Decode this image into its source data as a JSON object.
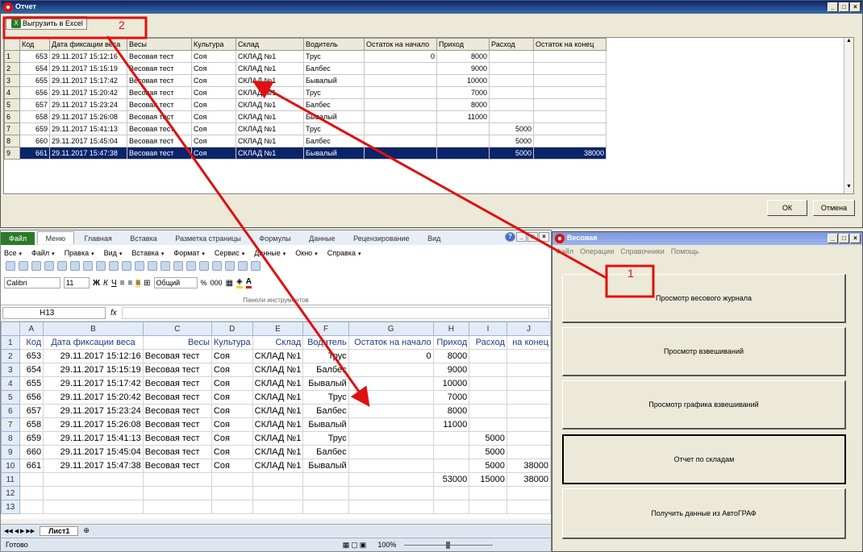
{
  "report": {
    "title": "Отчет",
    "export_label": "Выгрузить в Excel",
    "columns": [
      "Код",
      "Дата фиксации веса",
      "Весы",
      "Культура",
      "Склад",
      "Водитель",
      "Остаток на начало",
      "Приход",
      "Расход",
      "Остаток на конец"
    ],
    "rows": [
      [
        "1",
        "653",
        "29.11.2017 15:12:16",
        "Весовая тест",
        "Соя",
        "СКЛАД №1",
        "Трус",
        "0",
        "8000",
        "",
        ""
      ],
      [
        "2",
        "654",
        "29.11.2017 15:15:19",
        "Весовая тест",
        "Соя",
        "СКЛАД №1",
        "Балбес",
        "",
        "9000",
        "",
        ""
      ],
      [
        "3",
        "655",
        "29.11.2017 15:17:42",
        "Весовая тест",
        "Соя",
        "СКЛАД №1",
        "Бывалый",
        "",
        "10000",
        "",
        ""
      ],
      [
        "4",
        "656",
        "29.11.2017 15:20:42",
        "Весовая тест",
        "Соя",
        "СКЛАД №1",
        "Трус",
        "",
        "7000",
        "",
        ""
      ],
      [
        "5",
        "657",
        "29.11.2017 15:23:24",
        "Весовая тест",
        "Соя",
        "СКЛАД №1",
        "Балбес",
        "",
        "8000",
        "",
        ""
      ],
      [
        "6",
        "658",
        "29.11.2017 15:26:08",
        "Весовая тест",
        "Соя",
        "СКЛАД №1",
        "Бывалый",
        "",
        "11000",
        "",
        ""
      ],
      [
        "7",
        "659",
        "29.11.2017 15:41:13",
        "Весовая тест",
        "Соя",
        "СКЛАД №1",
        "Трус",
        "",
        "",
        "5000",
        ""
      ],
      [
        "8",
        "660",
        "29.11.2017 15:45:04",
        "Весовая тест",
        "Соя",
        "СКЛАД №1",
        "Балбес",
        "",
        "",
        "5000",
        ""
      ],
      [
        "9",
        "661",
        "29.11.2017 15:47:38",
        "Весовая тест",
        "Соя",
        "СКЛАД №1",
        "Бывалый",
        "",
        "",
        "5000",
        "38000"
      ]
    ],
    "ok_label": "ОК",
    "cancel_label": "Отмена"
  },
  "excel": {
    "tabs": [
      "Файл",
      "Меню",
      "Главная",
      "Вставка",
      "Разметка страницы",
      "Формулы",
      "Данные",
      "Рецензирование",
      "Вид"
    ],
    "menus": [
      "Все",
      "Файл",
      "Правка",
      "Вид",
      "Вставка",
      "Формат",
      "Сервис",
      "Данные",
      "Окно",
      "Справка"
    ],
    "font": "Calibri",
    "font_size": "11",
    "number_format": "Общий",
    "toolbar_group": "Панели инструментов",
    "name_box": "H13",
    "fx": "fx",
    "col_headers": [
      "A",
      "B",
      "C",
      "D",
      "E",
      "F",
      "G",
      "H",
      "I",
      "J"
    ],
    "rows": [
      [
        "1",
        "Код",
        "Дата фиксации веса",
        "Весы",
        "Культура",
        "Склад",
        "Водитель",
        "Остаток на начало",
        "Приход",
        "Расход",
        "на конец"
      ],
      [
        "2",
        "653",
        "29.11.2017 15:12:16",
        "Весовая тест",
        "Соя",
        "СКЛАД №1",
        "Трус",
        "0",
        "8000",
        "",
        ""
      ],
      [
        "3",
        "654",
        "29.11.2017 15:15:19",
        "Весовая тест",
        "Соя",
        "СКЛАД №1",
        "Балбес",
        "",
        "9000",
        "",
        ""
      ],
      [
        "4",
        "655",
        "29.11.2017 15:17:42",
        "Весовая тест",
        "Соя",
        "СКЛАД №1",
        "Бывалый",
        "",
        "10000",
        "",
        ""
      ],
      [
        "5",
        "656",
        "29.11.2017 15:20:42",
        "Весовая тест",
        "Соя",
        "СКЛАД №1",
        "Трус",
        "",
        "7000",
        "",
        ""
      ],
      [
        "6",
        "657",
        "29.11.2017 15:23:24",
        "Весовая тест",
        "Соя",
        "СКЛАД №1",
        "Балбес",
        "",
        "8000",
        "",
        ""
      ],
      [
        "7",
        "658",
        "29.11.2017 15:26:08",
        "Весовая тест",
        "Соя",
        "СКЛАД №1",
        "Бывалый",
        "",
        "11000",
        "",
        ""
      ],
      [
        "8",
        "659",
        "29.11.2017 15:41:13",
        "Весовая тест",
        "Соя",
        "СКЛАД №1",
        "Трус",
        "",
        "",
        "5000",
        ""
      ],
      [
        "9",
        "660",
        "29.11.2017 15:45:04",
        "Весовая тест",
        "Соя",
        "СКЛАД №1",
        "Балбес",
        "",
        "",
        "5000",
        ""
      ],
      [
        "10",
        "661",
        "29.11.2017 15:47:38",
        "Весовая тест",
        "Соя",
        "СКЛАД №1",
        "Бывалый",
        "",
        "",
        "5000",
        "38000"
      ],
      [
        "11",
        "",
        "",
        "",
        "",
        "",
        "",
        "",
        "53000",
        "15000",
        "38000"
      ],
      [
        "12",
        "",
        "",
        "",
        "",
        "",
        "",
        "",
        "",
        "",
        ""
      ],
      [
        "13",
        "",
        "",
        "",
        "",
        "",
        "",
        "",
        "",
        "",
        ""
      ]
    ],
    "sheet_tab": "Лист1",
    "status": "Готово",
    "zoom": "100%"
  },
  "vesovaya": {
    "title": "Весовая",
    "menus": [
      "Файл",
      "Операции",
      "Справочники",
      "Помощь"
    ],
    "buttons": [
      "Просмотр весового журнала",
      "Просмотр взвешиваний",
      "Просмотр графика взвешиваний",
      "Отчет по складам",
      "Получить данные  из АвтоГРАФ"
    ]
  },
  "annotations": {
    "label1": "1",
    "label2": "2",
    "color": "#e01010"
  }
}
